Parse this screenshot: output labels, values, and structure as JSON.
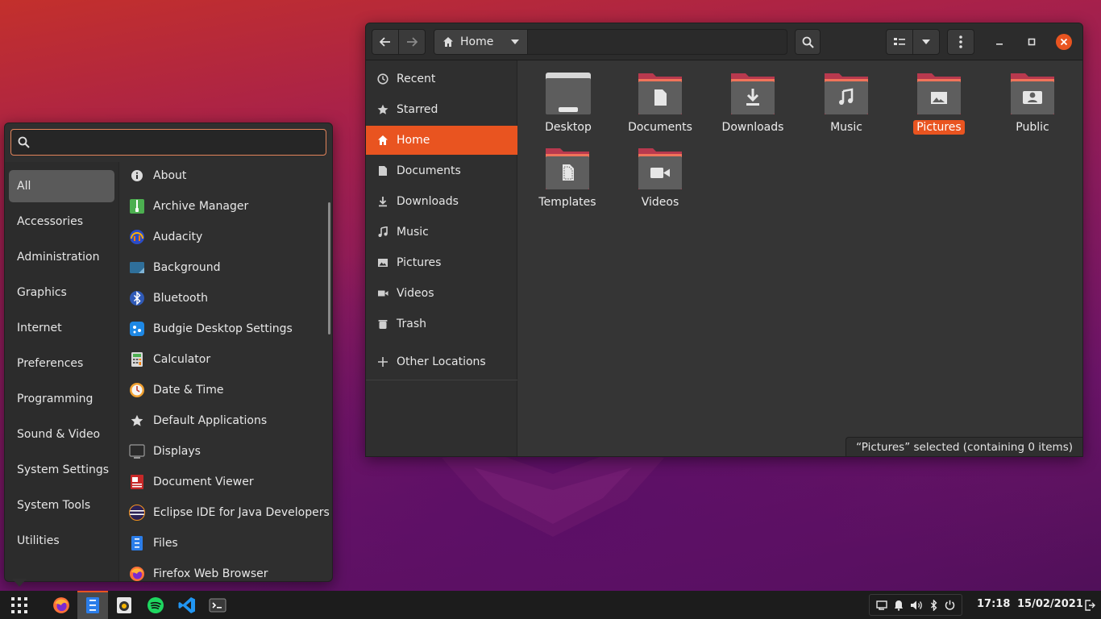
{
  "files": {
    "path_label": "Home",
    "sidebar": [
      {
        "label": "Recent",
        "icon": "clock-icon"
      },
      {
        "label": "Starred",
        "icon": "star-icon"
      },
      {
        "label": "Home",
        "icon": "home-icon"
      },
      {
        "label": "Documents",
        "icon": "document-icon"
      },
      {
        "label": "Downloads",
        "icon": "download-icon"
      },
      {
        "label": "Music",
        "icon": "music-icon"
      },
      {
        "label": "Pictures",
        "icon": "picture-icon"
      },
      {
        "label": "Videos",
        "icon": "video-icon"
      },
      {
        "label": "Trash",
        "icon": "trash-icon"
      },
      {
        "label": "Other Locations",
        "icon": "plus-icon"
      }
    ],
    "folders": [
      {
        "label": "Desktop"
      },
      {
        "label": "Documents"
      },
      {
        "label": "Downloads"
      },
      {
        "label": "Music"
      },
      {
        "label": "Pictures"
      },
      {
        "label": "Public"
      },
      {
        "label": "Templates"
      },
      {
        "label": "Videos"
      }
    ],
    "status": "“Pictures” selected  (containing 0 items)"
  },
  "menu": {
    "search_value": "",
    "categories": [
      "All",
      "Accessories",
      "Administration",
      "Graphics",
      "Internet",
      "Preferences",
      "Programming",
      "Sound & Video",
      "System Settings",
      "System Tools",
      "Utilities"
    ],
    "apps": [
      "About",
      "Archive Manager",
      "Audacity",
      "Background",
      "Bluetooth",
      "Budgie Desktop Settings",
      "Calculator",
      "Date & Time",
      "Default Applications",
      "Displays",
      "Document Viewer",
      "Eclipse IDE for Java Developers",
      "Files",
      "Firefox Web Browser"
    ]
  },
  "panel": {
    "time": "17:18",
    "date": "15/02/2021"
  },
  "colors": {
    "accent": "#e95420",
    "folder_tab": "#b8394e",
    "folder_body": "#5e5e5e"
  }
}
